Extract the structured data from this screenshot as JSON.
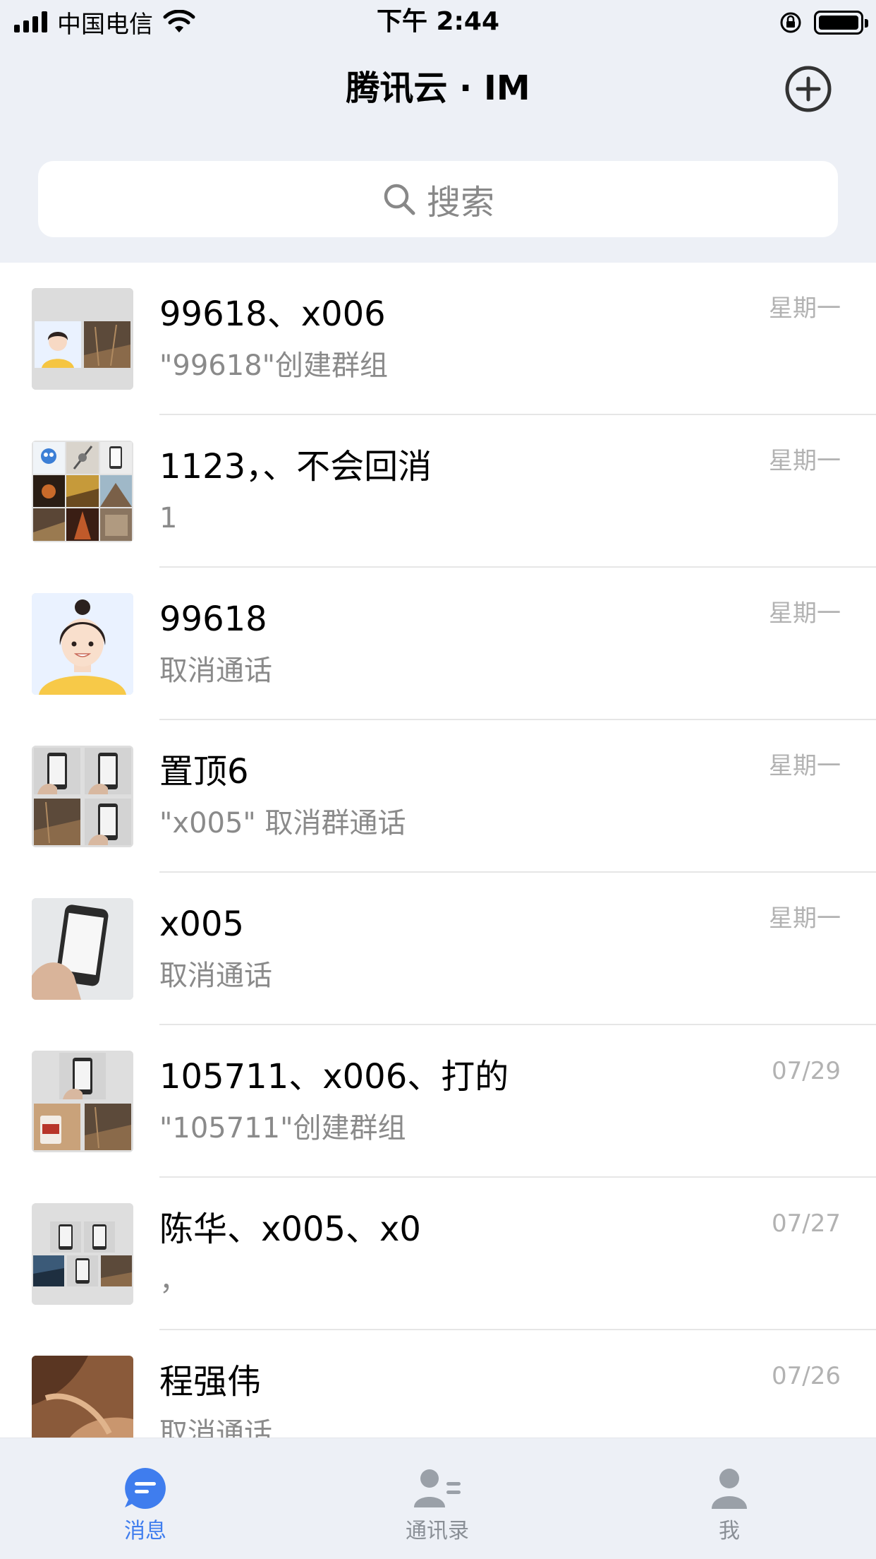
{
  "status_bar": {
    "carrier": "中国电信",
    "time": "下午 2:44"
  },
  "header": {
    "title": "腾讯云 · IM",
    "add_icon": "plus-circle-icon"
  },
  "search": {
    "placeholder": "搜索",
    "icon": "search-icon"
  },
  "conversations": [
    {
      "name": "99618、x006",
      "message": "\"99618\"创建群组",
      "time": "星期一",
      "avatar": "group-avatar"
    },
    {
      "name": "1123，、不会回消",
      "message": "1",
      "time": "星期一",
      "avatar": "group-avatar"
    },
    {
      "name": "99618",
      "message": "取消通话",
      "time": "星期一",
      "avatar": "user-avatar"
    },
    {
      "name": "置顶6",
      "message": "\"x005\" 取消群通话",
      "time": "星期一",
      "avatar": "group-avatar"
    },
    {
      "name": "x005",
      "message": "取消通话",
      "time": "星期一",
      "avatar": "user-avatar"
    },
    {
      "name": "105711、x006、打的",
      "message": "\"105711\"创建群组",
      "time": "07/29",
      "avatar": "group-avatar"
    },
    {
      "name": "陈华、x005、x0",
      "message": "，",
      "time": "07/27",
      "avatar": "group-avatar"
    },
    {
      "name": "程强伟",
      "message": "取消通话",
      "time": "07/26",
      "avatar": "user-avatar"
    }
  ],
  "tabs": [
    {
      "label": "消息",
      "icon": "chat-bubble-icon",
      "active": true
    },
    {
      "label": "通讯录",
      "icon": "contacts-icon",
      "active": false
    },
    {
      "label": "我",
      "icon": "profile-icon",
      "active": false
    }
  ],
  "colors": {
    "accent": "#3f7dee",
    "inactive": "#9aa0a8",
    "header_bg": "#edf0f6"
  }
}
